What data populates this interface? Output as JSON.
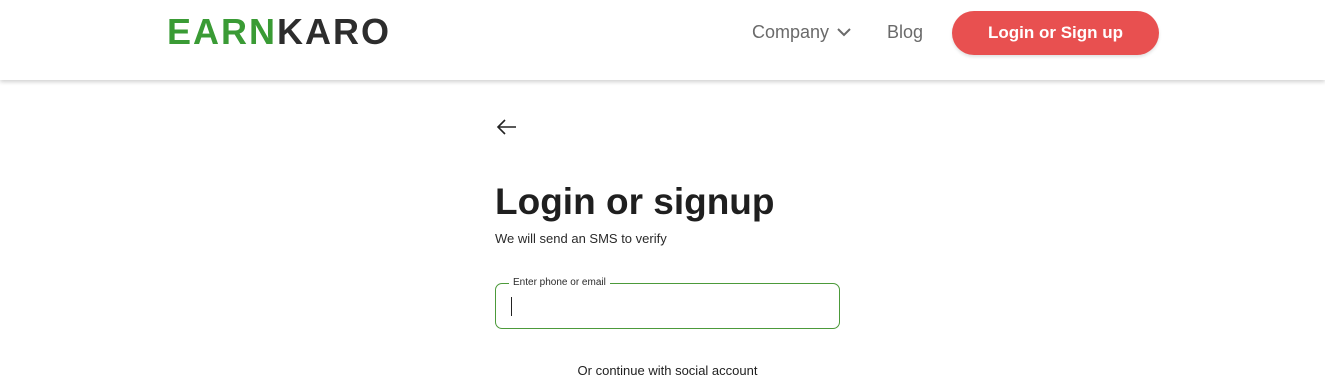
{
  "header": {
    "logo": {
      "part1": "EARN",
      "part2": "KARO"
    },
    "nav": {
      "company": "Company",
      "blog": "Blog"
    },
    "cta_label": "Login or Sign up"
  },
  "main": {
    "title": "Login or signup",
    "subtitle": "We will send an SMS to verify",
    "field": {
      "label": "Enter phone or email",
      "value": ""
    },
    "social_text": "Or continue with social account"
  },
  "colors": {
    "brand_green": "#3a9b35",
    "brand_dark": "#2d2d2d",
    "cta_red": "#e85050",
    "field_border": "#4c9a3a"
  },
  "icons": {
    "back": "back-arrow-icon",
    "dropdown": "chevron-down-icon"
  }
}
